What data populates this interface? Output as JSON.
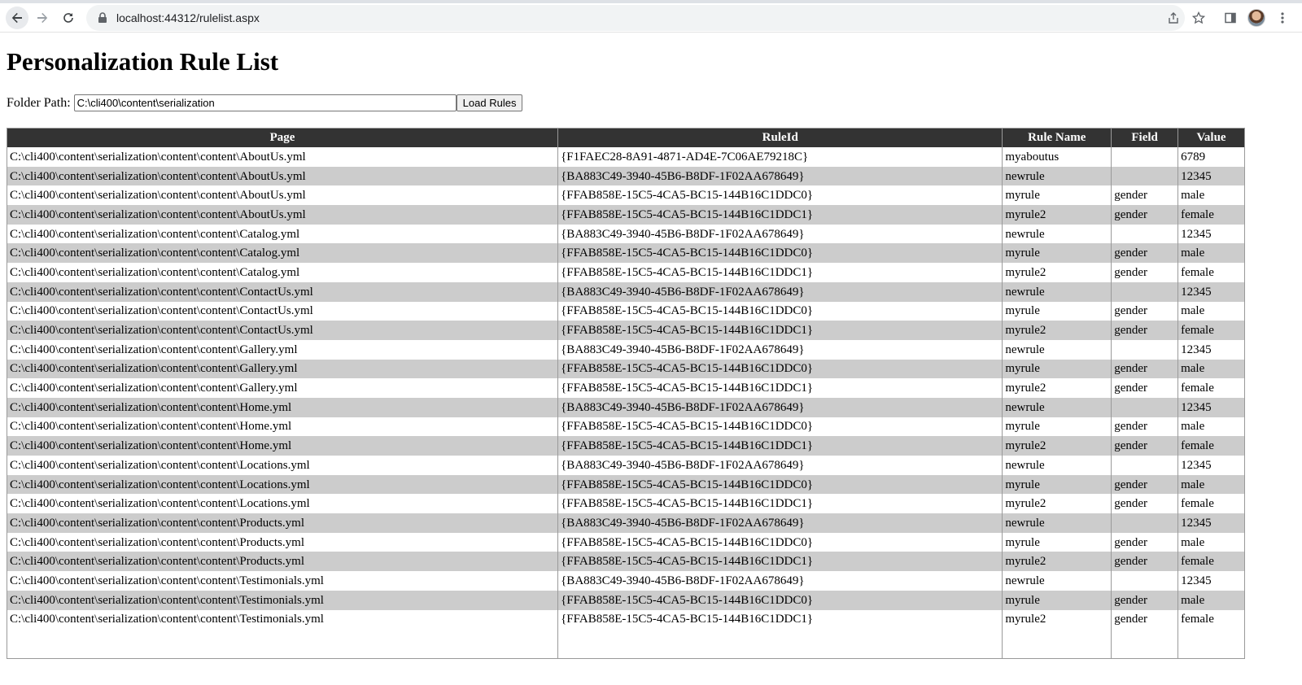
{
  "browser": {
    "url": "localhost:44312/rulelist.aspx"
  },
  "page": {
    "title": "Personalization Rule List",
    "folder_label": "Folder Path:",
    "folder_value": "C:\\cli400\\content\\serialization",
    "load_button": "Load Rules"
  },
  "table": {
    "headers": [
      "Page",
      "RuleId",
      "Rule Name",
      "Field",
      "Value"
    ],
    "rows": [
      {
        "page": "C:\\cli400\\content\\serialization\\content\\content\\AboutUs.yml",
        "id": "{F1FAEC28-8A91-4871-AD4E-7C06AE79218C}",
        "name": "myaboutus",
        "field": "",
        "value": "6789"
      },
      {
        "page": "C:\\cli400\\content\\serialization\\content\\content\\AboutUs.yml",
        "id": "{BA883C49-3940-45B6-B8DF-1F02AA678649}",
        "name": "newrule",
        "field": "",
        "value": "12345"
      },
      {
        "page": "C:\\cli400\\content\\serialization\\content\\content\\AboutUs.yml",
        "id": "{FFAB858E-15C5-4CA5-BC15-144B16C1DDC0}",
        "name": "myrule",
        "field": "gender",
        "value": "male"
      },
      {
        "page": "C:\\cli400\\content\\serialization\\content\\content\\AboutUs.yml",
        "id": "{FFAB858E-15C5-4CA5-BC15-144B16C1DDC1}",
        "name": "myrule2",
        "field": "gender",
        "value": "female"
      },
      {
        "page": "C:\\cli400\\content\\serialization\\content\\content\\Catalog.yml",
        "id": "{BA883C49-3940-45B6-B8DF-1F02AA678649}",
        "name": "newrule",
        "field": "",
        "value": "12345"
      },
      {
        "page": "C:\\cli400\\content\\serialization\\content\\content\\Catalog.yml",
        "id": "{FFAB858E-15C5-4CA5-BC15-144B16C1DDC0}",
        "name": "myrule",
        "field": "gender",
        "value": "male"
      },
      {
        "page": "C:\\cli400\\content\\serialization\\content\\content\\Catalog.yml",
        "id": "{FFAB858E-15C5-4CA5-BC15-144B16C1DDC1}",
        "name": "myrule2",
        "field": "gender",
        "value": "female"
      },
      {
        "page": "C:\\cli400\\content\\serialization\\content\\content\\ContactUs.yml",
        "id": "{BA883C49-3940-45B6-B8DF-1F02AA678649}",
        "name": "newrule",
        "field": "",
        "value": "12345"
      },
      {
        "page": "C:\\cli400\\content\\serialization\\content\\content\\ContactUs.yml",
        "id": "{FFAB858E-15C5-4CA5-BC15-144B16C1DDC0}",
        "name": "myrule",
        "field": "gender",
        "value": "male"
      },
      {
        "page": "C:\\cli400\\content\\serialization\\content\\content\\ContactUs.yml",
        "id": "{FFAB858E-15C5-4CA5-BC15-144B16C1DDC1}",
        "name": "myrule2",
        "field": "gender",
        "value": "female"
      },
      {
        "page": "C:\\cli400\\content\\serialization\\content\\content\\Gallery.yml",
        "id": "{BA883C49-3940-45B6-B8DF-1F02AA678649}",
        "name": "newrule",
        "field": "",
        "value": "12345"
      },
      {
        "page": "C:\\cli400\\content\\serialization\\content\\content\\Gallery.yml",
        "id": "{FFAB858E-15C5-4CA5-BC15-144B16C1DDC0}",
        "name": "myrule",
        "field": "gender",
        "value": "male"
      },
      {
        "page": "C:\\cli400\\content\\serialization\\content\\content\\Gallery.yml",
        "id": "{FFAB858E-15C5-4CA5-BC15-144B16C1DDC1}",
        "name": "myrule2",
        "field": "gender",
        "value": "female"
      },
      {
        "page": "C:\\cli400\\content\\serialization\\content\\content\\Home.yml",
        "id": "{BA883C49-3940-45B6-B8DF-1F02AA678649}",
        "name": "newrule",
        "field": "",
        "value": "12345"
      },
      {
        "page": "C:\\cli400\\content\\serialization\\content\\content\\Home.yml",
        "id": "{FFAB858E-15C5-4CA5-BC15-144B16C1DDC0}",
        "name": "myrule",
        "field": "gender",
        "value": "male"
      },
      {
        "page": "C:\\cli400\\content\\serialization\\content\\content\\Home.yml",
        "id": "{FFAB858E-15C5-4CA5-BC15-144B16C1DDC1}",
        "name": "myrule2",
        "field": "gender",
        "value": "female"
      },
      {
        "page": "C:\\cli400\\content\\serialization\\content\\content\\Locations.yml",
        "id": "{BA883C49-3940-45B6-B8DF-1F02AA678649}",
        "name": "newrule",
        "field": "",
        "value": "12345"
      },
      {
        "page": "C:\\cli400\\content\\serialization\\content\\content\\Locations.yml",
        "id": "{FFAB858E-15C5-4CA5-BC15-144B16C1DDC0}",
        "name": "myrule",
        "field": "gender",
        "value": "male"
      },
      {
        "page": "C:\\cli400\\content\\serialization\\content\\content\\Locations.yml",
        "id": "{FFAB858E-15C5-4CA5-BC15-144B16C1DDC1}",
        "name": "myrule2",
        "field": "gender",
        "value": "female"
      },
      {
        "page": "C:\\cli400\\content\\serialization\\content\\content\\Products.yml",
        "id": "{BA883C49-3940-45B6-B8DF-1F02AA678649}",
        "name": "newrule",
        "field": "",
        "value": "12345"
      },
      {
        "page": "C:\\cli400\\content\\serialization\\content\\content\\Products.yml",
        "id": "{FFAB858E-15C5-4CA5-BC15-144B16C1DDC0}",
        "name": "myrule",
        "field": "gender",
        "value": "male"
      },
      {
        "page": "C:\\cli400\\content\\serialization\\content\\content\\Products.yml",
        "id": "{FFAB858E-15C5-4CA5-BC15-144B16C1DDC1}",
        "name": "myrule2",
        "field": "gender",
        "value": "female"
      },
      {
        "page": "C:\\cli400\\content\\serialization\\content\\content\\Testimonials.yml",
        "id": "{BA883C49-3940-45B6-B8DF-1F02AA678649}",
        "name": "newrule",
        "field": "",
        "value": "12345"
      },
      {
        "page": "C:\\cli400\\content\\serialization\\content\\content\\Testimonials.yml",
        "id": "{FFAB858E-15C5-4CA5-BC15-144B16C1DDC0}",
        "name": "myrule",
        "field": "gender",
        "value": "male"
      },
      {
        "page": "C:\\cli400\\content\\serialization\\content\\content\\Testimonials.yml",
        "id": "{FFAB858E-15C5-4CA5-BC15-144B16C1DDC1}",
        "name": "myrule2",
        "field": "gender",
        "value": "female"
      }
    ]
  },
  "colors": {
    "header_bg": "#333333",
    "alt_row_bg": "#cccccc"
  },
  "icons": [
    "back-icon",
    "forward-icon",
    "reload-icon",
    "lock-icon",
    "share-icon",
    "star-icon",
    "side-panel-icon",
    "avatar",
    "menu-icon"
  ]
}
